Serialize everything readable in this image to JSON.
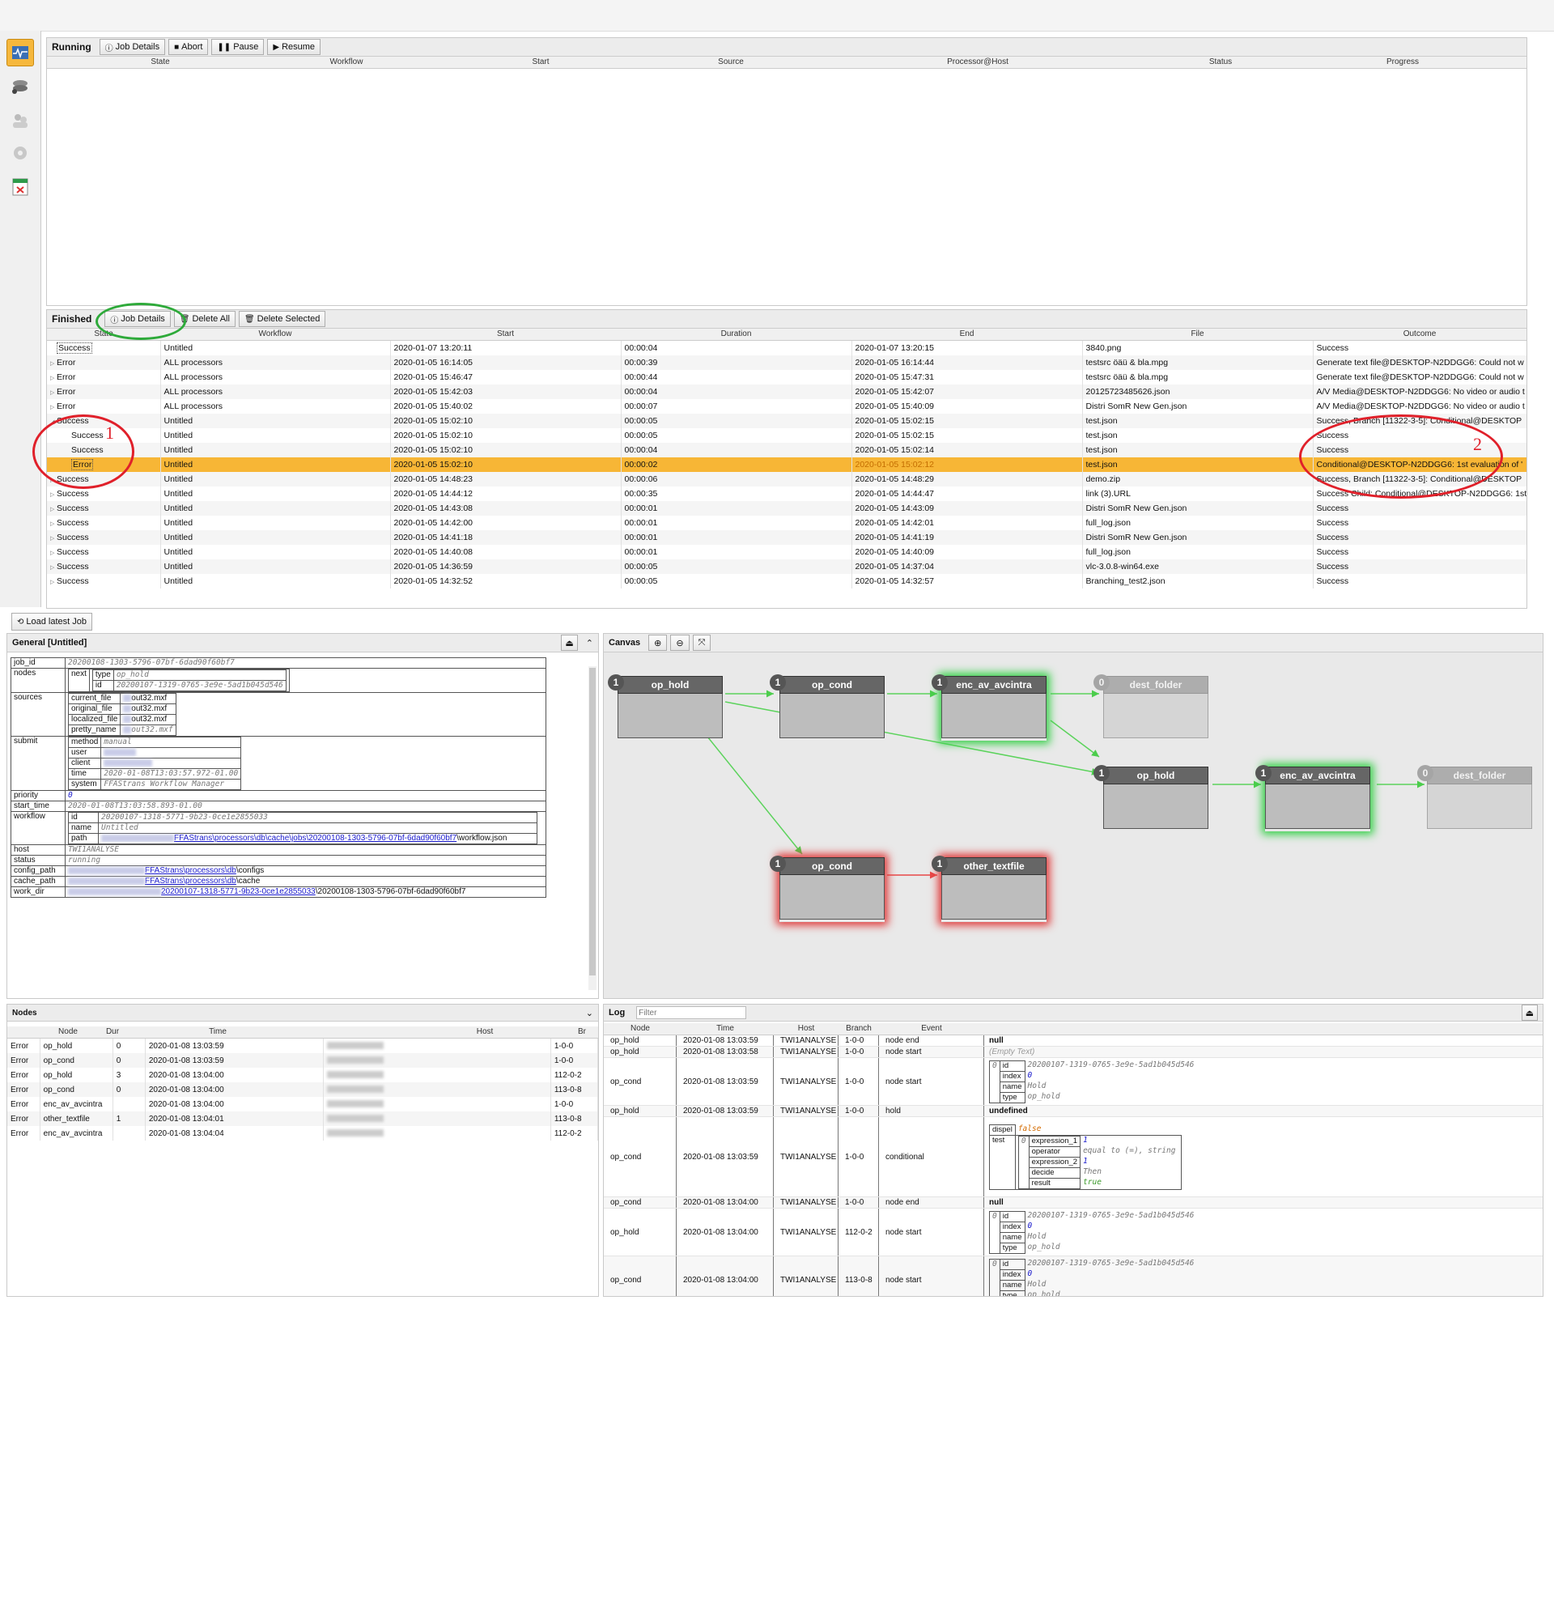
{
  "running": {
    "title": "Running",
    "buttons": {
      "job_details": "Job Details",
      "abort": "Abort",
      "pause": "Pause",
      "resume": "Resume"
    },
    "columns": [
      "State",
      "Workflow",
      "Start",
      "Source",
      "Processor@Host",
      "Status",
      "Progress"
    ]
  },
  "finished": {
    "title": "Finished",
    "buttons": {
      "job_details": "Job Details",
      "delete_all": "Delete All",
      "delete_selected": "Delete Selected"
    },
    "columns": [
      "State",
      "Workflow",
      "Start",
      "Duration",
      "End",
      "File",
      "Outcome"
    ],
    "rows": [
      {
        "state": "Success",
        "workflow": "Untitled",
        "start": "2020-01-07 13:20:11",
        "duration": "00:00:04",
        "end": "2020-01-07 13:20:15",
        "file": "3840.png",
        "outcome": "Success"
      },
      {
        "state": "Error",
        "workflow": "ALL processors",
        "start": "2020-01-05 16:14:05",
        "duration": "00:00:39",
        "end": "2020-01-05 16:14:44",
        "file": "testsrc öäü & bla.mpg",
        "outcome": "Generate text file@DESKTOP-N2DDGG6: Could not w"
      },
      {
        "state": "Error",
        "workflow": "ALL processors",
        "start": "2020-01-05 15:46:47",
        "duration": "00:00:44",
        "end": "2020-01-05 15:47:31",
        "file": "testsrc öäü & bla.mpg",
        "outcome": "Generate text file@DESKTOP-N2DDGG6: Could not w"
      },
      {
        "state": "Error",
        "workflow": "ALL processors",
        "start": "2020-01-05 15:42:03",
        "duration": "00:00:04",
        "end": "2020-01-05 15:42:07",
        "file": "20125723485626.json",
        "outcome": "A/V Media@DESKTOP-N2DDGG6: No video or audio t"
      },
      {
        "state": "Error",
        "workflow": "ALL processors",
        "start": "2020-01-05 15:40:02",
        "duration": "00:00:07",
        "end": "2020-01-05 15:40:09",
        "file": "Distri SomR New Gen.json",
        "outcome": "A/V Media@DESKTOP-N2DDGG6: No video or audio t"
      },
      {
        "state": "Success",
        "workflow": "Untitled",
        "start": "2020-01-05 15:02:10",
        "duration": "00:00:05",
        "end": "2020-01-05 15:02:15",
        "file": "test.json",
        "outcome": "Success, Branch [11322-3-5]: Conditional@DESKTOP"
      },
      {
        "state": "Success",
        "workflow": "Untitled",
        "start": "2020-01-05 15:02:10",
        "duration": "00:00:05",
        "end": "2020-01-05 15:02:15",
        "file": "test.json",
        "outcome": "Success"
      },
      {
        "state": "Success",
        "workflow": "Untitled",
        "start": "2020-01-05 15:02:10",
        "duration": "00:00:04",
        "end": "2020-01-05 15:02:14",
        "file": "test.json",
        "outcome": "Success"
      },
      {
        "state": "Error",
        "workflow": "Untitled",
        "start": "2020-01-05 15:02:10",
        "duration": "00:00:02",
        "end": "2020-01-05 15:02:12",
        "file": "test.json",
        "outcome": "Conditional@DESKTOP-N2DDGG6: 1st evaluation of '"
      },
      {
        "state": "Success",
        "workflow": "Untitled",
        "start": "2020-01-05 14:48:23",
        "duration": "00:00:06",
        "end": "2020-01-05 14:48:29",
        "file": "demo.zip",
        "outcome": "Success, Branch [11322-3-5]: Conditional@DESKTOP"
      },
      {
        "state": "Success",
        "workflow": "Untitled",
        "start": "2020-01-05 14:44:12",
        "duration": "00:00:35",
        "end": "2020-01-05 14:44:47",
        "file": "link (3).URL",
        "outcome": "Success Child: Conditional@DESKTOP-N2DDGG6: 1st"
      },
      {
        "state": "Success",
        "workflow": "Untitled",
        "start": "2020-01-05 14:43:08",
        "duration": "00:00:01",
        "end": "2020-01-05 14:43:09",
        "file": "Distri SomR New Gen.json",
        "outcome": "Success"
      },
      {
        "state": "Success",
        "workflow": "Untitled",
        "start": "2020-01-05 14:42:00",
        "duration": "00:00:01",
        "end": "2020-01-05 14:42:01",
        "file": "full_log.json",
        "outcome": "Success"
      },
      {
        "state": "Success",
        "workflow": "Untitled",
        "start": "2020-01-05 14:41:18",
        "duration": "00:00:01",
        "end": "2020-01-05 14:41:19",
        "file": "Distri SomR New Gen.json",
        "outcome": "Success"
      },
      {
        "state": "Success",
        "workflow": "Untitled",
        "start": "2020-01-05 14:40:08",
        "duration": "00:00:01",
        "end": "2020-01-05 14:40:09",
        "file": "full_log.json",
        "outcome": "Success"
      },
      {
        "state": "Success",
        "workflow": "Untitled",
        "start": "2020-01-05 14:36:59",
        "duration": "00:00:05",
        "end": "2020-01-05 14:37:04",
        "file": "vlc-3.0.8-win64.exe",
        "outcome": "Success"
      },
      {
        "state": "Success",
        "workflow": "Untitled",
        "start": "2020-01-05 14:32:52",
        "duration": "00:00:05",
        "end": "2020-01-05 14:32:57",
        "file": "Branching_test2.json",
        "outcome": "Success"
      }
    ]
  },
  "annotations": {
    "one": "1",
    "two": "2"
  },
  "load_latest": "Load latest Job",
  "general": {
    "title": "General [Untitled]",
    "job_id": {
      "k": "job_id",
      "v": "20200108-1303-5796-07bf-6dad90f60bf7"
    },
    "nodes": {
      "k": "nodes",
      "next": "next",
      "type_k": "type",
      "type_v": "op_hold",
      "id_k": "id",
      "id_v": "20200107-1319-0765-3e9e-5ad1b045d546"
    },
    "sources": {
      "k": "sources",
      "rows": [
        [
          "current_file",
          "out32.mxf"
        ],
        [
          "original_file",
          "out32.mxf"
        ],
        [
          "localized_file",
          "out32.mxf"
        ],
        [
          "pretty_name",
          "out32.mxf"
        ]
      ]
    },
    "submit": {
      "k": "submit",
      "rows": [
        [
          "method",
          "manual"
        ],
        [
          "user",
          ""
        ],
        [
          "client",
          ""
        ],
        [
          "time",
          "2020-01-08T13:03:57.972-01.00"
        ],
        [
          "system",
          "FFAStrans Workflow Manager"
        ]
      ]
    },
    "priority": {
      "k": "priority",
      "v": "0"
    },
    "start_time": {
      "k": "start_time",
      "v": "2020-01-08T13:03:58.893-01.00"
    },
    "workflow": {
      "k": "workflow",
      "id_k": "id",
      "id_v": "20200107-1318-5771-9b23-0ce1e2855033",
      "name_k": "name",
      "name_v": "Untitled",
      "path_k": "path",
      "path_link": "FFAStrans\\processors\\db\\cache\\jobs\\20200108-1303-5796-07bf-6dad90f60bf7",
      "path_tail": "\\workflow.json"
    },
    "host": {
      "k": "host",
      "v": "TWI1ANALYSE"
    },
    "status": {
      "k": "status",
      "v": "running"
    },
    "config_path": {
      "k": "config_path",
      "link": "FFAStrans\\processors\\db",
      "tail": "\\configs"
    },
    "cache_path": {
      "k": "cache_path",
      "link": "FFAStrans\\processors\\db",
      "tail": "\\cache"
    },
    "work_dir": {
      "k": "work_dir",
      "link": "20200107-1318-5771-9b23-0ce1e2855033",
      "tail": "\\20200108-1303-5796-07bf-6dad90f60bf7"
    }
  },
  "nodes_panel": {
    "title": "Nodes",
    "columns": [
      "",
      "Node",
      "Dur",
      "Time",
      "",
      "Host",
      "Br"
    ],
    "rows": [
      {
        "state": "Error",
        "node": "op_hold",
        "dur": "0",
        "time": "2020-01-08 13:03:59",
        "br": "1-0-0"
      },
      {
        "state": "Error",
        "node": "op_cond",
        "dur": "0",
        "time": "2020-01-08 13:03:59",
        "br": "1-0-0"
      },
      {
        "state": "Error",
        "node": "op_hold",
        "dur": "3",
        "time": "2020-01-08 13:04:00",
        "br": "112-0-2"
      },
      {
        "state": "Error",
        "node": "op_cond",
        "dur": "0",
        "time": "2020-01-08 13:04:00",
        "br": "113-0-8"
      },
      {
        "state": "Error",
        "node": "enc_av_avcintra",
        "dur": "",
        "time": "2020-01-08 13:04:00",
        "br": "1-0-0"
      },
      {
        "state": "Error",
        "node": "other_textfile",
        "dur": "1",
        "time": "2020-01-08 13:04:01",
        "br": "113-0-8"
      },
      {
        "state": "Error",
        "node": "enc_av_avcintra",
        "dur": "",
        "time": "2020-01-08 13:04:04",
        "br": "112-0-2"
      }
    ]
  },
  "canvas": {
    "title": "Canvas",
    "nodes": [
      {
        "id": "n1",
        "label": "op_hold",
        "badge": "1",
        "style": "normal"
      },
      {
        "id": "n2",
        "label": "op_cond",
        "badge": "1",
        "style": "normal"
      },
      {
        "id": "n3",
        "label": "enc_av_avcintra",
        "badge": "1",
        "style": "green"
      },
      {
        "id": "n4",
        "label": "dest_folder",
        "badge": "0",
        "style": "faded"
      },
      {
        "id": "n5",
        "label": "op_hold",
        "badge": "1",
        "style": "normal"
      },
      {
        "id": "n6",
        "label": "enc_av_avcintra",
        "badge": "1",
        "style": "green"
      },
      {
        "id": "n7",
        "label": "dest_folder",
        "badge": "0",
        "style": "faded"
      },
      {
        "id": "n8",
        "label": "op_cond",
        "badge": "1",
        "style": "red"
      },
      {
        "id": "n9",
        "label": "other_textfile",
        "badge": "1",
        "style": "red"
      }
    ]
  },
  "log": {
    "title": "Log",
    "filter_placeholder": "Filter",
    "columns": [
      "Node",
      "Time",
      "Host",
      "Branch",
      "Event"
    ],
    "rows": [
      {
        "node": "op_hold",
        "time": "2020-01-08 13:03:59",
        "host": "TWI1ANALYSE",
        "branch": "1-0-0",
        "event": "node end",
        "detail": "null"
      },
      {
        "node": "op_hold",
        "time": "2020-01-08 13:03:58",
        "host": "TWI1ANALYSE",
        "branch": "1-0-0",
        "event": "node start",
        "detail": "(Empty Text)"
      },
      {
        "node": "op_cond",
        "time": "2020-01-08 13:03:59",
        "host": "TWI1ANALYSE",
        "branch": "1-0-0",
        "event": "node start",
        "detail": "kv"
      },
      {
        "node": "op_hold",
        "time": "2020-01-08 13:03:59",
        "host": "TWI1ANALYSE",
        "branch": "1-0-0",
        "event": "hold",
        "detail": "undefined"
      },
      {
        "node": "op_cond",
        "time": "2020-01-08 13:03:59",
        "host": "TWI1ANALYSE",
        "branch": "1-0-0",
        "event": "conditional",
        "detail": "cond"
      },
      {
        "node": "op_cond",
        "time": "2020-01-08 13:04:00",
        "host": "TWI1ANALYSE",
        "branch": "1-0-0",
        "event": "node end",
        "detail": "null"
      },
      {
        "node": "op_hold",
        "time": "2020-01-08 13:04:00",
        "host": "TWI1ANALYSE",
        "branch": "112-0-2",
        "event": "node start",
        "detail": "kv"
      },
      {
        "node": "op_cond",
        "time": "2020-01-08 13:04:00",
        "host": "TWI1ANALYSE",
        "branch": "113-0-8",
        "event": "node start",
        "detail": "kv2"
      }
    ],
    "kv": {
      "zero": "0",
      "id_k": "id",
      "id_v": "20200107-1319-0765-3e9e-5ad1b045d546",
      "index_k": "index",
      "index_v": "0",
      "name_k": "name",
      "name_v": "Hold",
      "type_k": "type",
      "type_v": "op_hold"
    },
    "cond": {
      "dispel_k": "dispel",
      "dispel_v": "false",
      "test_k": "test",
      "zero": "0",
      "e1_k": "expression_1",
      "e1_v": "1",
      "op_k": "operator",
      "op_v": "equal to (=), string",
      "e2_k": "expression_2",
      "e2_v": "1",
      "decide_k": "decide",
      "decide_v": "Then",
      "result_k": "result",
      "result_v": "true"
    }
  }
}
